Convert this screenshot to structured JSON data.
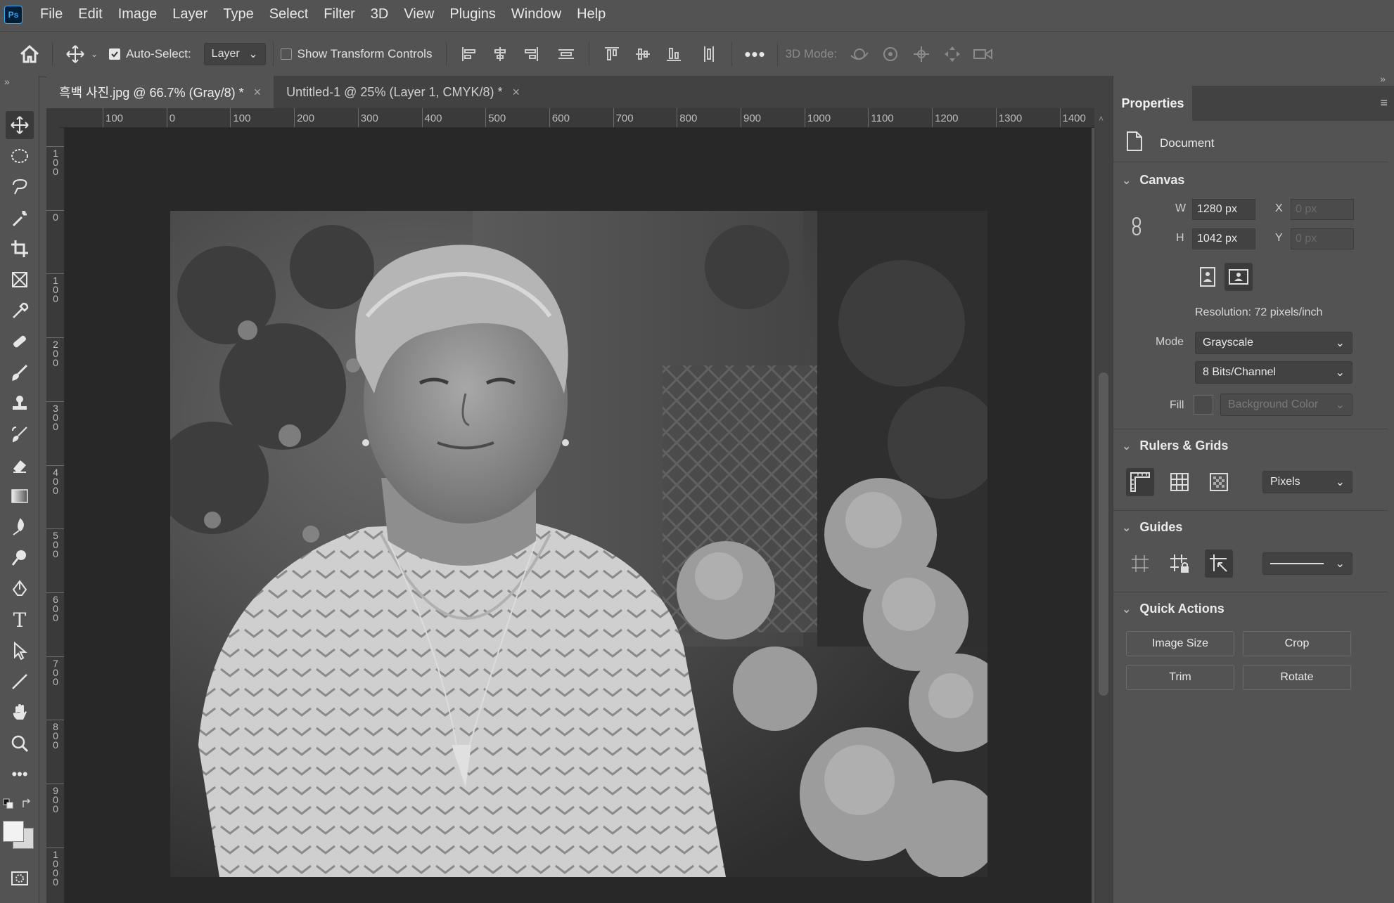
{
  "app": {
    "logo_text": "Ps",
    "accent": "#31a8ff"
  },
  "menu": [
    "File",
    "Edit",
    "Image",
    "Layer",
    "Type",
    "Select",
    "Filter",
    "3D",
    "View",
    "Plugins",
    "Window",
    "Help"
  ],
  "options": {
    "auto_select_label": "Auto-Select:",
    "auto_select_checked": true,
    "auto_select_target": "Layer",
    "show_transform_label": "Show Transform Controls",
    "show_transform_checked": false,
    "mode_3d_label": "3D Mode:"
  },
  "tabs": [
    {
      "label": "흑백 사진.jpg @ 66.7% (Gray/8) *",
      "active": true
    },
    {
      "label": "Untitled-1 @ 25% (Layer 1, CMYK/8) *",
      "active": false
    }
  ],
  "ruler": {
    "h_labels": [
      "100",
      "0",
      "100",
      "200",
      "300",
      "400",
      "500",
      "600",
      "700",
      "800",
      "900",
      "1000",
      "1100",
      "1200",
      "1300",
      "1400"
    ],
    "v_labels": [
      "100",
      "0",
      "100",
      "200",
      "300",
      "400",
      "500",
      "600",
      "700",
      "800",
      "900",
      "1000"
    ]
  },
  "properties": {
    "title": "Properties",
    "document_label": "Document",
    "canvas": {
      "heading": "Canvas",
      "w_label": "W",
      "w_value": "1280 px",
      "h_label": "H",
      "h_value": "1042 px",
      "x_label": "X",
      "x_value": "0 px",
      "y_label": "Y",
      "y_value": "0 px",
      "resolution": "Resolution: 72 pixels/inch",
      "mode_label": "Mode",
      "mode_value": "Grayscale",
      "bits_value": "8 Bits/Channel",
      "fill_label": "Fill",
      "fill_value": "Background Color"
    },
    "rulers_grids": {
      "heading": "Rulers & Grids",
      "units": "Pixels"
    },
    "guides": {
      "heading": "Guides"
    },
    "quick_actions": {
      "heading": "Quick Actions",
      "buttons": [
        "Image Size",
        "Crop",
        "Trim",
        "Rotate"
      ]
    }
  },
  "photo": {
    "description_icon": "portrait-photo"
  }
}
